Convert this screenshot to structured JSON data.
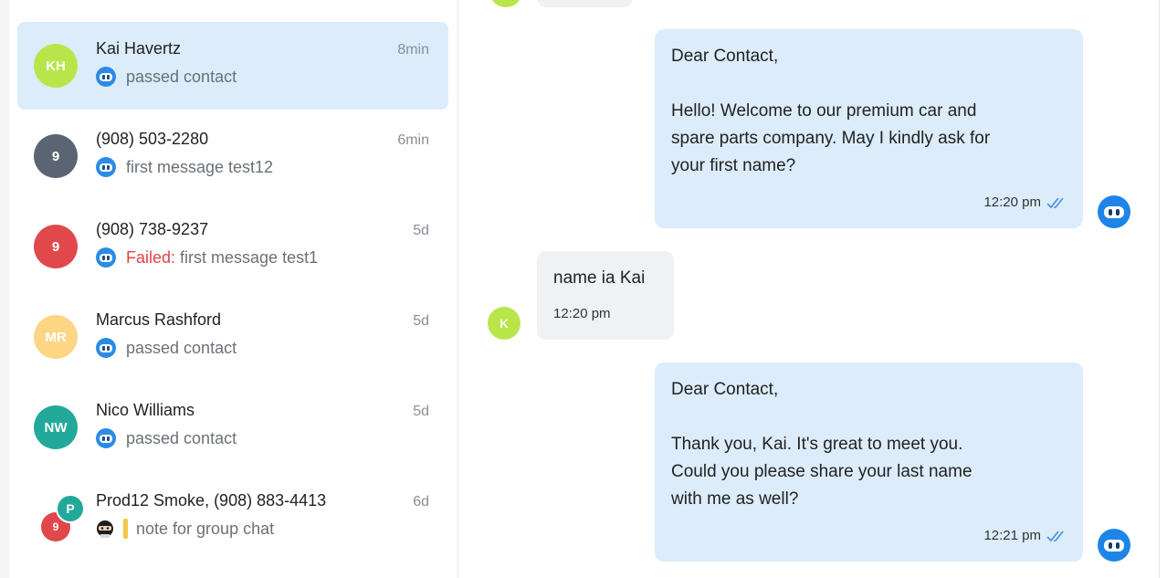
{
  "conversations": [
    {
      "initials": "KH",
      "name": "Kai Havertz",
      "time": "8min",
      "preview": "passed contact",
      "color": "#b8e64a"
    },
    {
      "initials": "9",
      "name": "(908) 503-2280",
      "time": "6min",
      "preview": "first message test12",
      "color": "#5b6472"
    },
    {
      "initials": "9",
      "name": "(908) 738-9237",
      "time": "5d",
      "status": "Failed:",
      "preview": "first message test1",
      "color": "#e0484b"
    },
    {
      "initials": "MR",
      "name": "Marcus Rashford",
      "time": "5d",
      "preview": "passed contact",
      "color": "#fdd585"
    },
    {
      "initials": "NW",
      "name": "Nico Williams",
      "time": "5d",
      "preview": "passed contact",
      "color": "#22a99a"
    },
    {
      "initials_a": "9",
      "initials_b": "P",
      "name": "Prod12 Smoke, (908) 883-4413",
      "time": "6d",
      "preview": "note for group chat"
    }
  ],
  "messages": [
    {
      "direction": "out",
      "greeting": "Dear Contact,",
      "body": "Hello! Welcome to our premium car and\nspare parts company. May I kindly ask for\nyour first name?",
      "time": "12:20 pm"
    },
    {
      "direction": "in",
      "avatar": "K",
      "body": "name ia Kai",
      "time": "12:20 pm"
    },
    {
      "direction": "out",
      "greeting": "Dear Contact,",
      "body": "Thank you, Kai. It's great to meet you.\nCould you please share your last name\nwith me as well?",
      "time": "12:21 pm"
    }
  ],
  "colors": {
    "active_bg": "#dcecfb",
    "accent": "#1e85e8",
    "failed": "#e04545"
  },
  "icons": {
    "bot": "robot-icon",
    "read": "double-check-icon",
    "note_author": "ninja-avatar-icon"
  }
}
